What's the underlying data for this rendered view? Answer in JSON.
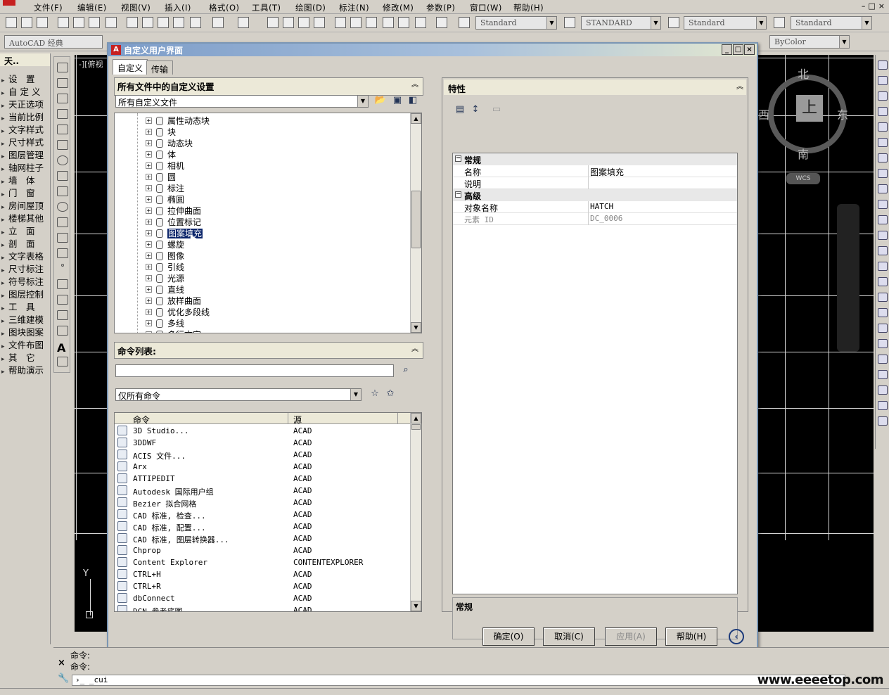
{
  "menubar": {
    "items": [
      "文件(F)",
      "编辑(E)",
      "视图(V)",
      "插入(I)",
      "格式(O)",
      "工具(T)",
      "绘图(D)",
      "标注(N)",
      "修改(M)",
      "参数(P)",
      "窗口(W)",
      "帮助(H)"
    ]
  },
  "toolbar": {
    "text_style": "Standard",
    "dim_style": "STANDARD",
    "table_style": "Standard",
    "mleader_style": "Standard",
    "workspace": "AutoCAD 经典",
    "color": "ByColor"
  },
  "left_palette": {
    "title": "天..",
    "items": [
      "设　置",
      "自 定 义",
      "天正选项",
      "当前比例",
      "文字样式",
      "尺寸样式",
      "图层管理",
      "轴网柱子",
      "墙　体",
      "门　窗",
      "房间屋顶",
      "楼梯其他",
      "立　面",
      "剖　面",
      "文字表格",
      "尺寸标注",
      "符号标注",
      "图层控制",
      "工　具",
      "三维建模",
      "图块图案",
      "文件布图",
      "其　它",
      "帮助演示"
    ]
  },
  "drawing": {
    "view_label": "-][俯视",
    "compass": {
      "north": "北",
      "south": "南",
      "east": "东",
      "west": "西",
      "cube": "上",
      "wcs": "WCS"
    },
    "ucs_y": "Y"
  },
  "dialog": {
    "title": "自定义用户界面",
    "tabs": [
      "自定义",
      "传输"
    ],
    "customizations": {
      "header": "所有文件中的自定义设置",
      "filter": "所有自定义文件",
      "tree_items": [
        "属性动态块",
        "块",
        "动态块",
        "体",
        "相机",
        "圆",
        "标注",
        "椭圆",
        "拉伸曲面",
        "位置标记",
        "图案填充",
        "螺旋",
        "图像",
        "引线",
        "光源",
        "直线",
        "放样曲面",
        "优化多段线",
        "多线",
        "多行文字"
      ],
      "selected_index": 10
    },
    "command_list": {
      "header": "命令列表:",
      "search_value": "",
      "filter": "仅所有命令",
      "columns": [
        "命令",
        "源"
      ],
      "rows": [
        {
          "name": "3D Studio...",
          "source": "ACAD"
        },
        {
          "name": "3DDWF",
          "source": "ACAD"
        },
        {
          "name": "ACIS 文件...",
          "source": "ACAD"
        },
        {
          "name": "Arx",
          "source": "ACAD"
        },
        {
          "name": "ATTIPEDIT",
          "source": "ACAD"
        },
        {
          "name": "Autodesk 国际用户组",
          "source": "ACAD"
        },
        {
          "name": "Bezier 拟合网格",
          "source": "ACAD"
        },
        {
          "name": "CAD 标准, 检查...",
          "source": "ACAD"
        },
        {
          "name": "CAD 标准, 配置...",
          "source": "ACAD"
        },
        {
          "name": "CAD 标准, 图层转换器...",
          "source": "ACAD"
        },
        {
          "name": "Chprop",
          "source": "ACAD"
        },
        {
          "name": "Content Explorer",
          "source": "CONTENTEXPLORER"
        },
        {
          "name": "CTRL+H",
          "source": "ACAD"
        },
        {
          "name": "CTRL+R",
          "source": "ACAD"
        },
        {
          "name": "dbConnect",
          "source": "ACAD"
        },
        {
          "name": "DGN 参考底图",
          "source": "ACAD"
        }
      ]
    },
    "properties": {
      "header": "特性",
      "categories": [
        {
          "name": "常规",
          "rows": [
            {
              "key": "名称",
              "value": "图案填充"
            },
            {
              "key": "说明",
              "value": ""
            }
          ]
        },
        {
          "name": "高级",
          "rows": [
            {
              "key": "对象名称",
              "value": "HATCH"
            },
            {
              "key": "元素 ID",
              "value": "DC_0006"
            }
          ]
        }
      ],
      "description_title": "常规"
    },
    "buttons": {
      "ok": "确定(O)",
      "cancel": "取消(C)",
      "apply": "应用(A)",
      "help": "帮助(H)"
    }
  },
  "command_window": {
    "line1": "命令:",
    "line2": "命令:",
    "input": "_cui"
  },
  "watermark": "www.eeeetop.com"
}
